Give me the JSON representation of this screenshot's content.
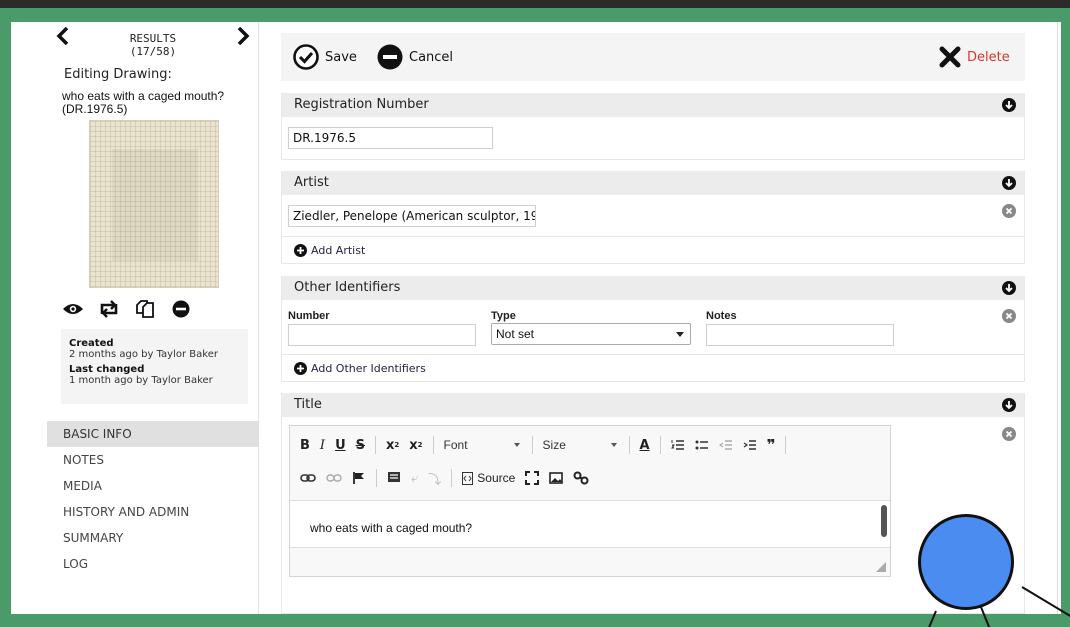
{
  "nav": {
    "results": "RESULTS",
    "count": "(17/58)"
  },
  "record": {
    "editing_label": "Editing Drawing:",
    "title_line": "who eats with a caged mouth?",
    "id_line": "(DR.1976.5)"
  },
  "meta": {
    "created_label": "Created",
    "created_value": "2 months ago by Taylor Baker",
    "changed_label": "Last changed",
    "changed_value": "1 month ago by Taylor Baker"
  },
  "sidenav": {
    "items": [
      {
        "label": "BASIC INFO"
      },
      {
        "label": "NOTES"
      },
      {
        "label": "MEDIA"
      },
      {
        "label": "HISTORY AND ADMIN"
      },
      {
        "label": "SUMMARY"
      },
      {
        "label": "LOG"
      }
    ]
  },
  "toolbar": {
    "save": "Save",
    "cancel": "Cancel",
    "delete": "Delete"
  },
  "registration": {
    "header": "Registration Number",
    "value": "DR.1976.5"
  },
  "artist": {
    "header": "Artist",
    "value": "Ziedler, Penelope (American sculptor, 19",
    "add": "Add Artist"
  },
  "other_ids": {
    "header": "Other Identifiers",
    "number_label": "Number",
    "type_label": "Type",
    "notes_label": "Notes",
    "type_value": "Not set",
    "add": "Add Other Identifiers"
  },
  "title_section": {
    "header": "Title",
    "font": "Font",
    "size": "Size",
    "source": "Source",
    "content": "who eats with a caged mouth?"
  },
  "colors": {
    "frame": "#4a9a6a",
    "accent": "#d23a2a",
    "avatar": "#4a8cf0"
  }
}
